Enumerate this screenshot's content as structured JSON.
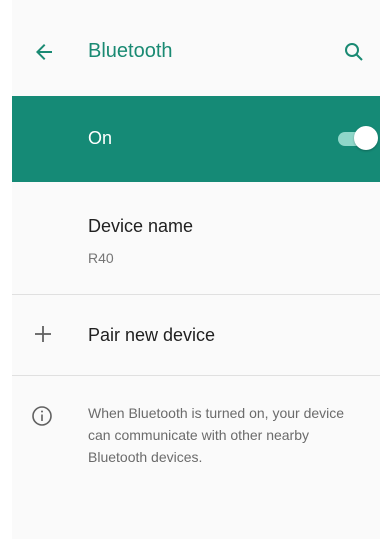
{
  "clipped_header": "p",
  "appbar": {
    "title": "Bluetooth",
    "back_icon": "arrow-left-icon",
    "search_icon": "search-icon"
  },
  "bluetooth_toggle": {
    "label": "On",
    "state": "on"
  },
  "device_name": {
    "title": "Device name",
    "value": "R40"
  },
  "pair_new_device": {
    "icon": "plus-icon",
    "label": "Pair new device"
  },
  "info": {
    "icon": "info-icon",
    "text": "When Bluetooth is turned on, your device can communicate with other nearby Bluetooth devices."
  },
  "colors": {
    "accent": "#158a76",
    "title_color": "#1a8a73",
    "divider": "#e0e0e0"
  }
}
